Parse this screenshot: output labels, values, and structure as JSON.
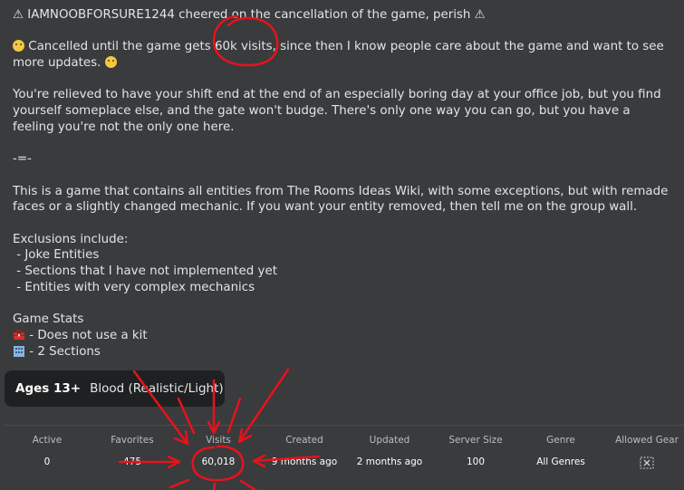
{
  "description": {
    "line1": "⚠ IAMNOOBFORSURE1244 cheered on the cancellation of the game, perish ⚠",
    "line2_text": " Cancelled until the game gets 60k visits, since then I know people care about the game and want to see more updates. ",
    "para2": "You're relieved to have your shift end at the end of an especially boring day at your office job, but you find yourself someplace else, and the gate won't budge. There's only one way you can go, but you have a feeling you're not the only one here.",
    "separator": "-=-",
    "para3": "This is a game that contains all entities from The Rooms Ideas Wiki, with some exceptions, but with remade faces or a slightly changed mechanic. If you want your entity removed, then tell me on the group wall.",
    "exclusions_title": "Exclusions include:",
    "exclusions": [
      " - Joke Entities",
      " - Sections that I have not implemented yet",
      " - Entities with very complex mechanics"
    ],
    "stats_title": "Game Stats",
    "stats_items": [
      " - Does not use a kit",
      " - 2 Sections"
    ]
  },
  "age_rating": {
    "age": "Ages 13+",
    "descriptor": "Blood (Realistic/Light)"
  },
  "game_stats": {
    "active_label": "Active",
    "active_value": "0",
    "favorites_label": "Favorites",
    "favorites_value": "475",
    "visits_label": "Visits",
    "visits_value": "60,018",
    "created_label": "Created",
    "created_value": "9 months ago",
    "updated_label": "Updated",
    "updated_value": "2 months ago",
    "server_size_label": "Server Size",
    "server_size_value": "100",
    "genre_label": "Genre",
    "genre_value": "All Genres",
    "allowed_gear_label": "Allowed Gear"
  },
  "colors": {
    "background": "#393b3d",
    "badge_background": "#1f2022",
    "annotation_red": "#e8121a",
    "emoji_yellow": "#f4c842"
  },
  "icons": {
    "sad_face": "frowning-face-emoji",
    "toolbox": "toolbox-emoji",
    "building": "building-emoji",
    "gear": "no-gear-icon"
  }
}
